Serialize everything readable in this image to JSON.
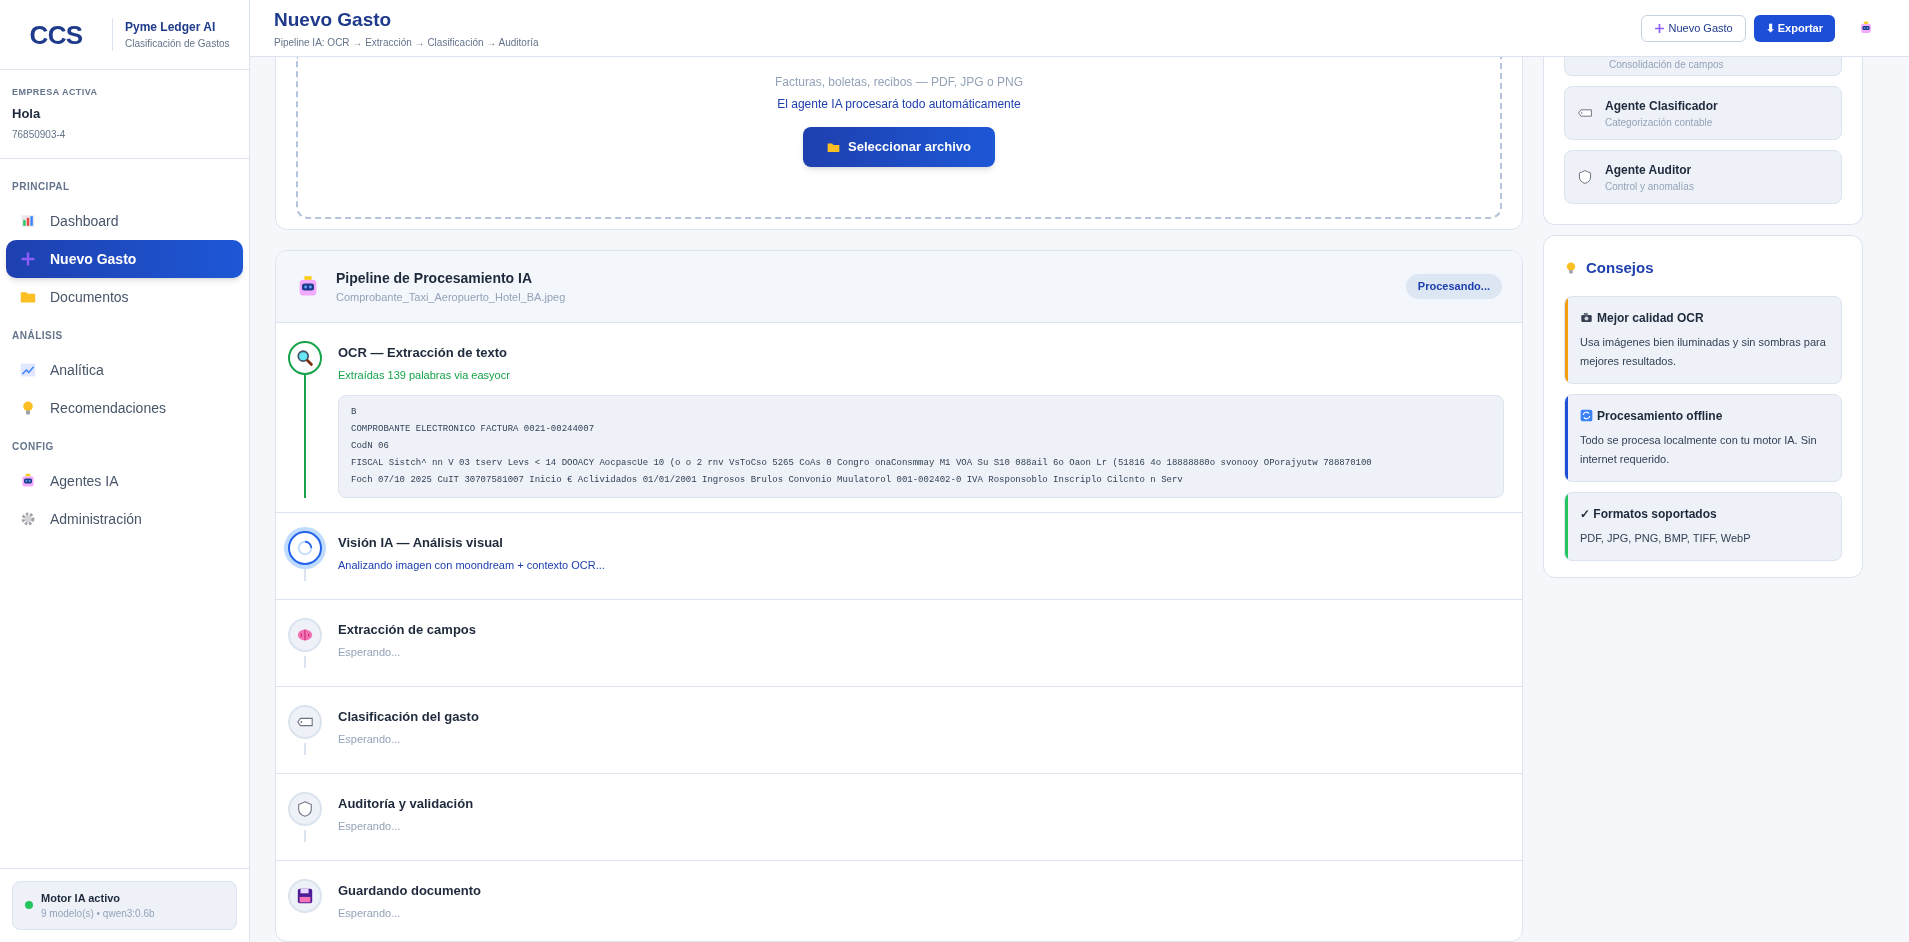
{
  "brand": {
    "logo_text": "CCS",
    "title": "Pyme Ledger AI",
    "subtitle": "Clasificación de Gastos"
  },
  "company": {
    "label": "EMPRESA ACTIVA",
    "name": "Hola",
    "id": "76850903-4"
  },
  "nav_sections": [
    {
      "title": "PRINCIPAL",
      "items": [
        {
          "label": "Dashboard",
          "selected": false
        },
        {
          "label": "Nuevo Gasto",
          "selected": true
        },
        {
          "label": "Documentos",
          "selected": false
        }
      ]
    },
    {
      "title": "ANÁLISIS",
      "items": [
        {
          "label": "Analítica",
          "selected": false
        },
        {
          "label": "Recomendaciones",
          "selected": false
        }
      ]
    },
    {
      "title": "CONFIG",
      "items": [
        {
          "label": "Agentes IA",
          "selected": false
        },
        {
          "label": "Administración",
          "selected": false
        }
      ]
    }
  ],
  "engine": {
    "title": "Motor IA activo",
    "detail": "9 modelo(s) • qwen3:0.6b",
    "on": true
  },
  "header": {
    "title": "Nuevo Gasto",
    "breadcrumb": "Pipeline IA: OCR → Extracción → Clasificación → Auditoría",
    "buttons": [
      {
        "label": "Nuevo Gasto",
        "kind": "outline"
      },
      {
        "label": "⬇ Exportar",
        "kind": "primary"
      }
    ]
  },
  "upload": {
    "hint": "Facturas, boletas, recibos — PDF, JPG o PNG",
    "note": "El agente IA procesará todo automáticamente",
    "button": "Seleccionar archivo"
  },
  "pipeline": {
    "title": "Pipeline de Procesamiento IA",
    "file": "Comprobante_Taxi_Aeropuerto_Hotel_BA.jpeg",
    "status": "Procesando...",
    "steps": [
      {
        "title": "OCR — Extracción de texto",
        "detail": "Extraídas 139 palabras via easyocr",
        "kind": "done",
        "output": [
          "B",
          "COMPROBANTE ELECTRONICO FACTURA 0021-00244007",
          "CodN 06",
          "FISCAL Sistch^ nn V 03 tserv Levs < 14 DOOACY AocpascUe 10 (o o 2 rnv VsToCso 5265 CoAs 0 Congro onaConsmmay M1 VOA Su S10 088ail 6o Oaon Lr (51816 4o 18888880o svonooy OPorajyutw 788870100",
          "Foch 07/10 2025 CuIT 30707581007 Inicio € Aclividados 01/01/2001 Ingrosos Brulos Convonio Muulatorol 001-002402-0 IVA Rosponsoblo Inscriplo Cilcnto n Serv"
        ]
      },
      {
        "title": "Visión IA — Análisis visual",
        "detail": "Analizando imagen con moondream + contexto OCR...",
        "kind": "active"
      },
      {
        "title": "Extracción de campos",
        "detail": "Esperando...",
        "kind": "pending"
      },
      {
        "title": "Clasificación del gasto",
        "detail": "Esperando...",
        "kind": "pending"
      },
      {
        "title": "Auditoría y validación",
        "detail": "Esperando...",
        "kind": "pending"
      },
      {
        "title": "Guardando documento",
        "detail": "Esperando...",
        "kind": "pending"
      }
    ]
  },
  "agents": [
    {
      "subtitle": "Consolidación de campos"
    },
    {
      "title": "Agente Clasificador",
      "subtitle": "Categorización contable"
    },
    {
      "title": "Agente Auditor",
      "subtitle": "Control y anomalías"
    }
  ],
  "tips": {
    "title": "Consejos",
    "items": [
      {
        "title": "Mejor calidad OCR",
        "text": "Usa imágenes bien iluminadas y sin sombras para mejores resultados.",
        "color": "#f59e0b"
      },
      {
        "title": "Procesamiento offline",
        "text": "Todo se procesa localmente con tu motor IA. Sin internet requerido.",
        "color": "#1d4ed8"
      },
      {
        "title": "✓ Formatos soportados",
        "text": "PDF, JPG, PNG, BMP, TIFF, WebP",
        "color": "#22c55e"
      }
    ]
  }
}
